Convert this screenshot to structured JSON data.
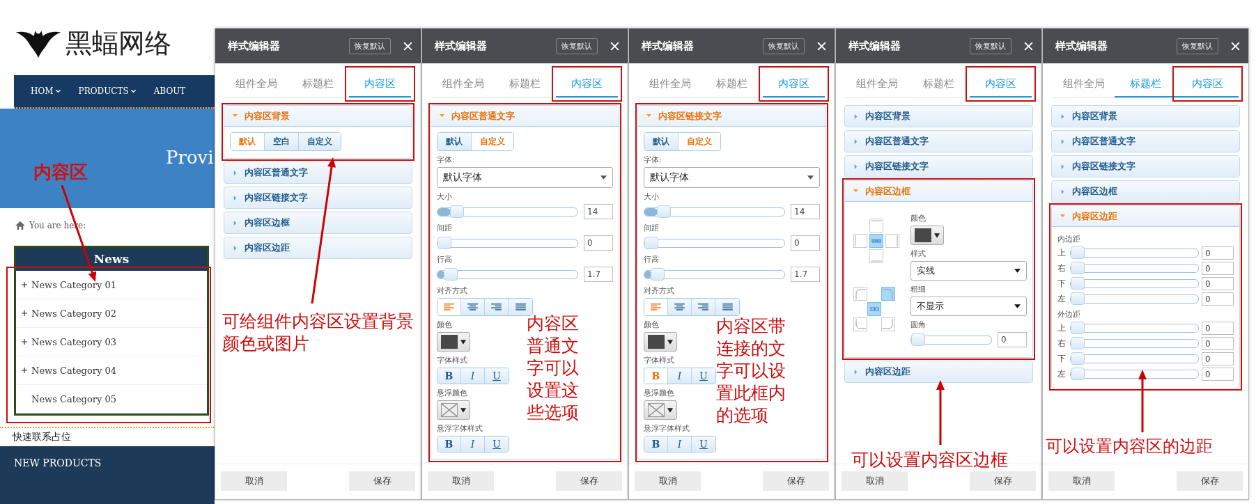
{
  "website": {
    "logo_text": "黑蝠网络",
    "nav": [
      {
        "label": "HOM",
        "has_menu": true
      },
      {
        "label": "PRODUCTS",
        "has_menu": true
      },
      {
        "label": "ABOUT",
        "has_menu": false
      }
    ],
    "banner_title": "Provi",
    "breadcrumb": "You are here:",
    "news": {
      "title": "News",
      "highlighted": true,
      "items": [
        {
          "label": "News Category 01",
          "has_children": true
        },
        {
          "label": "News Category 02",
          "has_children": true
        },
        {
          "label": "News Category 03",
          "has_children": true
        },
        {
          "label": "News Category 04",
          "has_children": true
        },
        {
          "label": "News Category 05",
          "has_children": false
        }
      ]
    },
    "contact": "快速联系占位",
    "products_title": "NEW PRODUCTS",
    "note": "内容区"
  },
  "panels": [
    {
      "title": "样式编辑器",
      "reset": "恢复默认",
      "tabs": [
        {
          "label": "组件全局",
          "selected": false,
          "hovered": false,
          "highlighted": false
        },
        {
          "label": "标题栏",
          "selected": false,
          "hovered": false,
          "highlighted": false
        },
        {
          "label": "内容区",
          "selected": true,
          "hovered": false,
          "highlighted": true
        }
      ],
      "sections": [
        {
          "title": "内容区背景",
          "expanded": true,
          "highlighted": true,
          "kind": "background",
          "options": [
            {
              "label": "默认",
              "selected": true
            },
            {
              "label": "空白",
              "selected": false
            },
            {
              "label": "自定义",
              "selected": false
            }
          ]
        },
        {
          "title": "内容区普通文字",
          "expanded": false,
          "highlighted": false
        },
        {
          "title": "内容区链接文字",
          "expanded": false,
          "highlighted": false
        },
        {
          "title": "内容区边框",
          "expanded": false,
          "highlighted": false
        },
        {
          "title": "内容区边距",
          "expanded": false,
          "highlighted": false
        }
      ],
      "note": {
        "text": "可给组件内容区设置背景颜色或图片",
        "arrow": true
      },
      "cancel": "取消",
      "save": "保存"
    },
    {
      "title": "样式编辑器",
      "reset": "恢复默认",
      "tabs": [
        {
          "label": "组件全局",
          "selected": false,
          "hovered": false,
          "highlighted": false
        },
        {
          "label": "标题栏",
          "selected": false,
          "hovered": false,
          "highlighted": false
        },
        {
          "label": "内容区",
          "selected": true,
          "hovered": false,
          "highlighted": true
        }
      ],
      "sections": [
        {
          "title": "内容区普通文字",
          "expanded": true,
          "highlighted": true,
          "kind": "text",
          "modes": [
            {
              "label": "默认",
              "selected": false
            },
            {
              "label": "自定义",
              "selected": true
            }
          ],
          "font_label": "字体:",
          "font": "默认字体",
          "sliders": [
            {
              "label": "大小",
              "level": 0.1,
              "value": "14"
            },
            {
              "label": "间距",
              "level": 0,
              "value": "0"
            },
            {
              "label": "行高",
              "level": 0.05,
              "value": "1.7"
            }
          ],
          "align_label": "对齐方式",
          "aligns": [
            {
              "kind": "left",
              "selected": true
            },
            {
              "kind": "center",
              "selected": false
            },
            {
              "kind": "right",
              "selected": false
            },
            {
              "kind": "justify",
              "selected": false
            }
          ],
          "color_label": "颜色",
          "swatch": {
            "kind": "solid",
            "color": "#484848"
          },
          "style_label": "字体样式",
          "styles": [
            {
              "label": "B",
              "kind": "bold",
              "selected": false
            },
            {
              "label": "I",
              "kind": "italic",
              "selected": false
            },
            {
              "label": "U",
              "kind": "underline",
              "selected": false
            }
          ],
          "hover_color_label": "悬浮颜色",
          "hover_swatch": {
            "kind": "empty"
          },
          "hover_style_label": "悬浮字体样式",
          "hover_styles": [
            {
              "label": "B",
              "kind": "bold",
              "selected": false
            },
            {
              "label": "I",
              "kind": "italic",
              "selected": false
            },
            {
              "label": "U",
              "kind": "underline",
              "selected": false
            }
          ]
        }
      ],
      "note": {
        "text": "内容区普通文字可以设置这些选项",
        "arrow": false
      },
      "cancel": "取消",
      "save": "保存"
    },
    {
      "title": "样式编辑器",
      "reset": "恢复默认",
      "tabs": [
        {
          "label": "组件全局",
          "selected": false,
          "hovered": false,
          "highlighted": false
        },
        {
          "label": "标题栏",
          "selected": false,
          "hovered": false,
          "highlighted": false
        },
        {
          "label": "内容区",
          "selected": true,
          "hovered": false,
          "highlighted": true
        }
      ],
      "sections": [
        {
          "title": "内容区链接文字",
          "expanded": true,
          "highlighted": true,
          "kind": "text",
          "modes": [
            {
              "label": "默认",
              "selected": false
            },
            {
              "label": "自定义",
              "selected": true
            }
          ],
          "font_label": "字体:",
          "font": "默认字体",
          "sliders": [
            {
              "label": "大小",
              "level": 0.1,
              "value": "14"
            },
            {
              "label": "间距",
              "level": 0,
              "value": "0"
            },
            {
              "label": "行高",
              "level": 0.05,
              "value": "1.7"
            }
          ],
          "align_label": "对齐方式",
          "aligns": [
            {
              "kind": "left",
              "selected": true
            },
            {
              "kind": "center",
              "selected": false
            },
            {
              "kind": "right",
              "selected": false
            },
            {
              "kind": "justify",
              "selected": false
            }
          ],
          "color_label": "颜色",
          "swatch": {
            "kind": "solid",
            "color": "#484848"
          },
          "style_label": "字体样式",
          "styles": [
            {
              "label": "B",
              "kind": "bold",
              "selected": true
            },
            {
              "label": "I",
              "kind": "italic",
              "selected": false
            },
            {
              "label": "U",
              "kind": "underline",
              "selected": false
            }
          ],
          "hover_color_label": "悬浮颜色",
          "hover_swatch": {
            "kind": "empty"
          },
          "hover_style_label": "悬浮字体样式",
          "hover_styles": [
            {
              "label": "B",
              "kind": "bold",
              "selected": false
            },
            {
              "label": "I",
              "kind": "italic",
              "selected": false
            },
            {
              "label": "U",
              "kind": "underline",
              "selected": false
            }
          ]
        }
      ],
      "note": {
        "text": "内容区带连接的文字可以设置此框内的选项",
        "arrow": false
      },
      "cancel": "取消",
      "save": "保存"
    },
    {
      "title": "样式编辑器",
      "reset": "恢复默认",
      "tabs": [
        {
          "label": "组件全局",
          "selected": false,
          "hovered": false,
          "highlighted": false
        },
        {
          "label": "标题栏",
          "selected": false,
          "hovered": false,
          "highlighted": false
        },
        {
          "label": "内容区",
          "selected": true,
          "hovered": false,
          "highlighted": true
        }
      ],
      "sections": [
        {
          "title": "内容区背景",
          "expanded": false,
          "highlighted": false
        },
        {
          "title": "内容区普通文字",
          "expanded": false,
          "highlighted": false
        },
        {
          "title": "内容区链接文字",
          "expanded": false,
          "highlighted": false
        },
        {
          "title": "内容区边框",
          "expanded": true,
          "highlighted": true,
          "kind": "border",
          "sides_linked": true,
          "color_label": "颜色",
          "swatch": {
            "kind": "solid",
            "color": "#484848"
          },
          "style_label": "样式",
          "style": "实线",
          "width_label": "粗细",
          "width": "不显示",
          "corners": [
            {
              "selected": false
            },
            {
              "selected": true
            },
            {
              "selected": false
            },
            {
              "selected": false
            }
          ],
          "corners_linked": true,
          "radius_label": "圆角",
          "radius": {
            "level": 0,
            "value": "0"
          }
        },
        {
          "title": "内容区边距",
          "expanded": false,
          "highlighted": false
        }
      ],
      "note": {
        "text": "可以设置内容区边框",
        "arrow": true
      },
      "cancel": "取消",
      "save": "保存"
    },
    {
      "title": "样式编辑器",
      "reset": "恢复默认",
      "tabs": [
        {
          "label": "组件全局",
          "selected": false,
          "hovered": false,
          "highlighted": false
        },
        {
          "label": "标题栏",
          "selected": false,
          "hovered": true,
          "highlighted": false
        },
        {
          "label": "内容区",
          "selected": true,
          "hovered": false,
          "highlighted": true
        }
      ],
      "sections": [
        {
          "title": "内容区背景",
          "expanded": false,
          "highlighted": false
        },
        {
          "title": "内容区普通文字",
          "expanded": false,
          "highlighted": false
        },
        {
          "title": "内容区链接文字",
          "expanded": false,
          "highlighted": false
        },
        {
          "title": "内容区边框",
          "expanded": false,
          "highlighted": false
        },
        {
          "title": "内容区边距",
          "expanded": true,
          "highlighted": true,
          "kind": "margin",
          "groups": [
            {
              "label": "内边距",
              "rows": [
                {
                  "label": "上",
                  "level": 0,
                  "value": "0"
                },
                {
                  "label": "右",
                  "level": 0,
                  "value": "0"
                },
                {
                  "label": "下",
                  "level": 0,
                  "value": "0"
                },
                {
                  "label": "左",
                  "level": 0,
                  "value": "0"
                }
              ]
            },
            {
              "label": "外边距",
              "rows": [
                {
                  "label": "上",
                  "level": 0,
                  "value": "0"
                },
                {
                  "label": "右",
                  "level": 0,
                  "value": "0"
                },
                {
                  "label": "下",
                  "level": 0,
                  "value": "0"
                },
                {
                  "label": "左",
                  "level": 0,
                  "value": "0"
                }
              ]
            }
          ]
        }
      ],
      "note": {
        "text": "可以设置内容区的边距",
        "arrow": true
      },
      "cancel": "取消",
      "save": "保存"
    }
  ]
}
